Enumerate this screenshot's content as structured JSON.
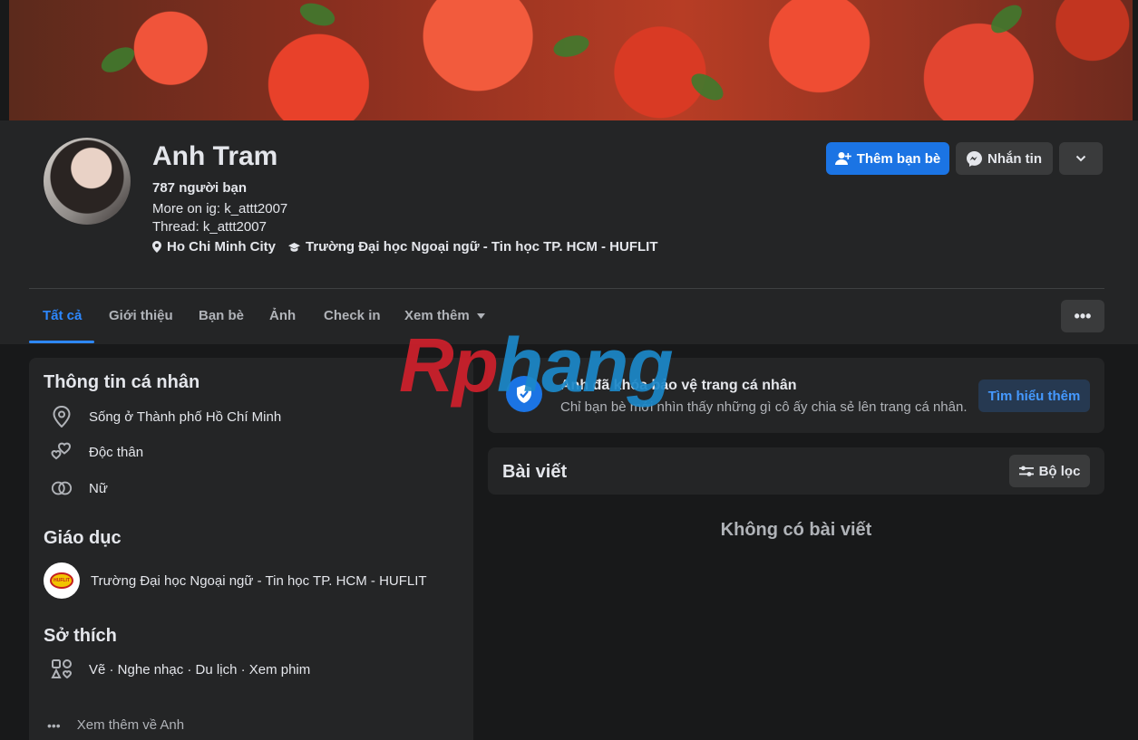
{
  "profile": {
    "name": "Anh Tram",
    "friends": "787 người bạn",
    "bio_line1": "More on ig: k_attt2007",
    "bio_line2": "Thread: k_attt2007",
    "location": "Ho Chi Minh City",
    "school": "Trường Đại học Ngoại ngữ - Tin học TP. HCM - HUFLIT"
  },
  "actions": {
    "add_friend": "Thêm bạn bè",
    "message": "Nhắn tin"
  },
  "tabs": [
    {
      "label": "Tất cả",
      "active": true
    },
    {
      "label": "Giới thiệu"
    },
    {
      "label": "Bạn bè"
    },
    {
      "label": "Ảnh"
    },
    {
      "label": "Check in"
    },
    {
      "label": "Xem thêm"
    }
  ],
  "intro": {
    "personal_title": "Thông tin cá nhân",
    "lives_in": "Sống ở Thành phố Hồ Chí Minh",
    "relationship": "Độc thân",
    "gender": "Nữ",
    "education_title": "Giáo dục",
    "school": "Trường Đại học Ngoại ngữ - Tin học TP. HCM - HUFLIT",
    "school_logo_text": "HUFLIT",
    "hobbies_title": "Sở thích",
    "hobbies": "Vẽ · Nghe nhạc · Du lịch · Xem phim",
    "see_more": "Xem thêm về Anh"
  },
  "lock_notice": {
    "title": "Anh đã khóa bảo vệ trang cá nhân",
    "subtitle": "Chỉ bạn bè mới nhìn thấy những gì cô ấy chia sẻ lên trang cá nhân.",
    "learn_more": "Tìm hiểu thêm"
  },
  "posts": {
    "title": "Bài viết",
    "filter": "Bộ lọc",
    "empty": "Không có bài viết"
  },
  "watermark": {
    "part1": "Rp",
    "part2": "hang"
  },
  "colors": {
    "accent": "#1b74e4",
    "active_tab": "#2d88ff",
    "bg": "#18191a",
    "card": "#242526"
  }
}
